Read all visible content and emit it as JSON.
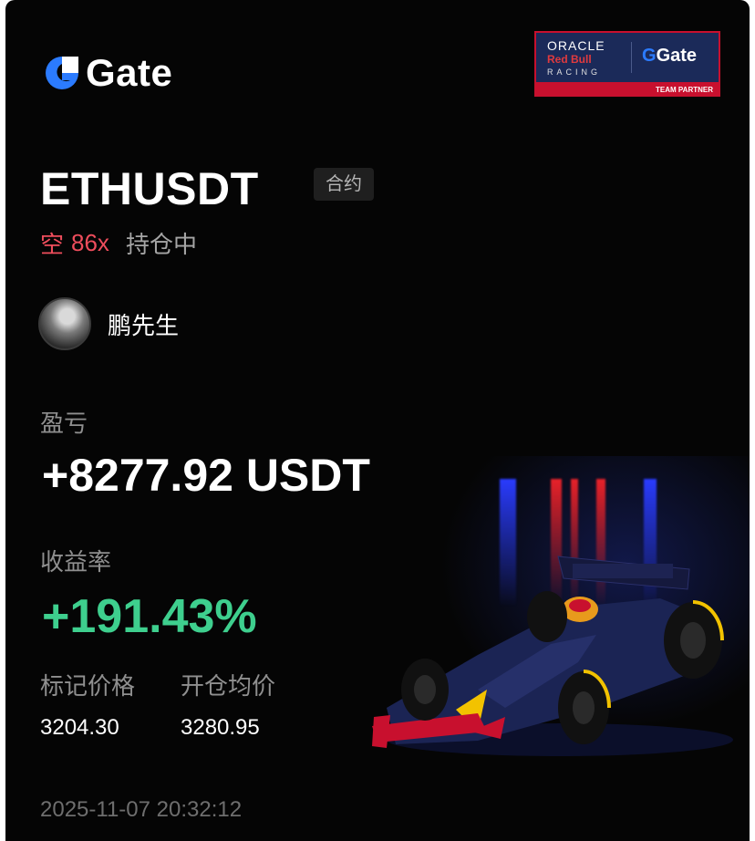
{
  "brand": {
    "name": "Gate",
    "accent": "#2b7bff"
  },
  "partner_badge": {
    "line1": "ORACLE",
    "line2": "Red Bull",
    "line3": "RACING",
    "brand": "Gate",
    "caption": "TEAM PARTNER"
  },
  "position": {
    "symbol": "ETHUSDT",
    "type_tag": "合约",
    "side": "空",
    "leverage": "86x",
    "status": "持仓中"
  },
  "trader": {
    "name": "鹏先生"
  },
  "pnl": {
    "label": "盈亏",
    "value": "+8277.92 USDT"
  },
  "roe": {
    "label": "收益率",
    "value": "+191.43%",
    "color": "#3ecf8e"
  },
  "mark_price": {
    "label": "标记价格",
    "value": "3204.30"
  },
  "entry_price": {
    "label": "开仓均价",
    "value": "3280.95"
  },
  "timestamp": "2025-11-07 20:32:12",
  "colors": {
    "short": "#ee4d5c",
    "background": "#050505"
  }
}
